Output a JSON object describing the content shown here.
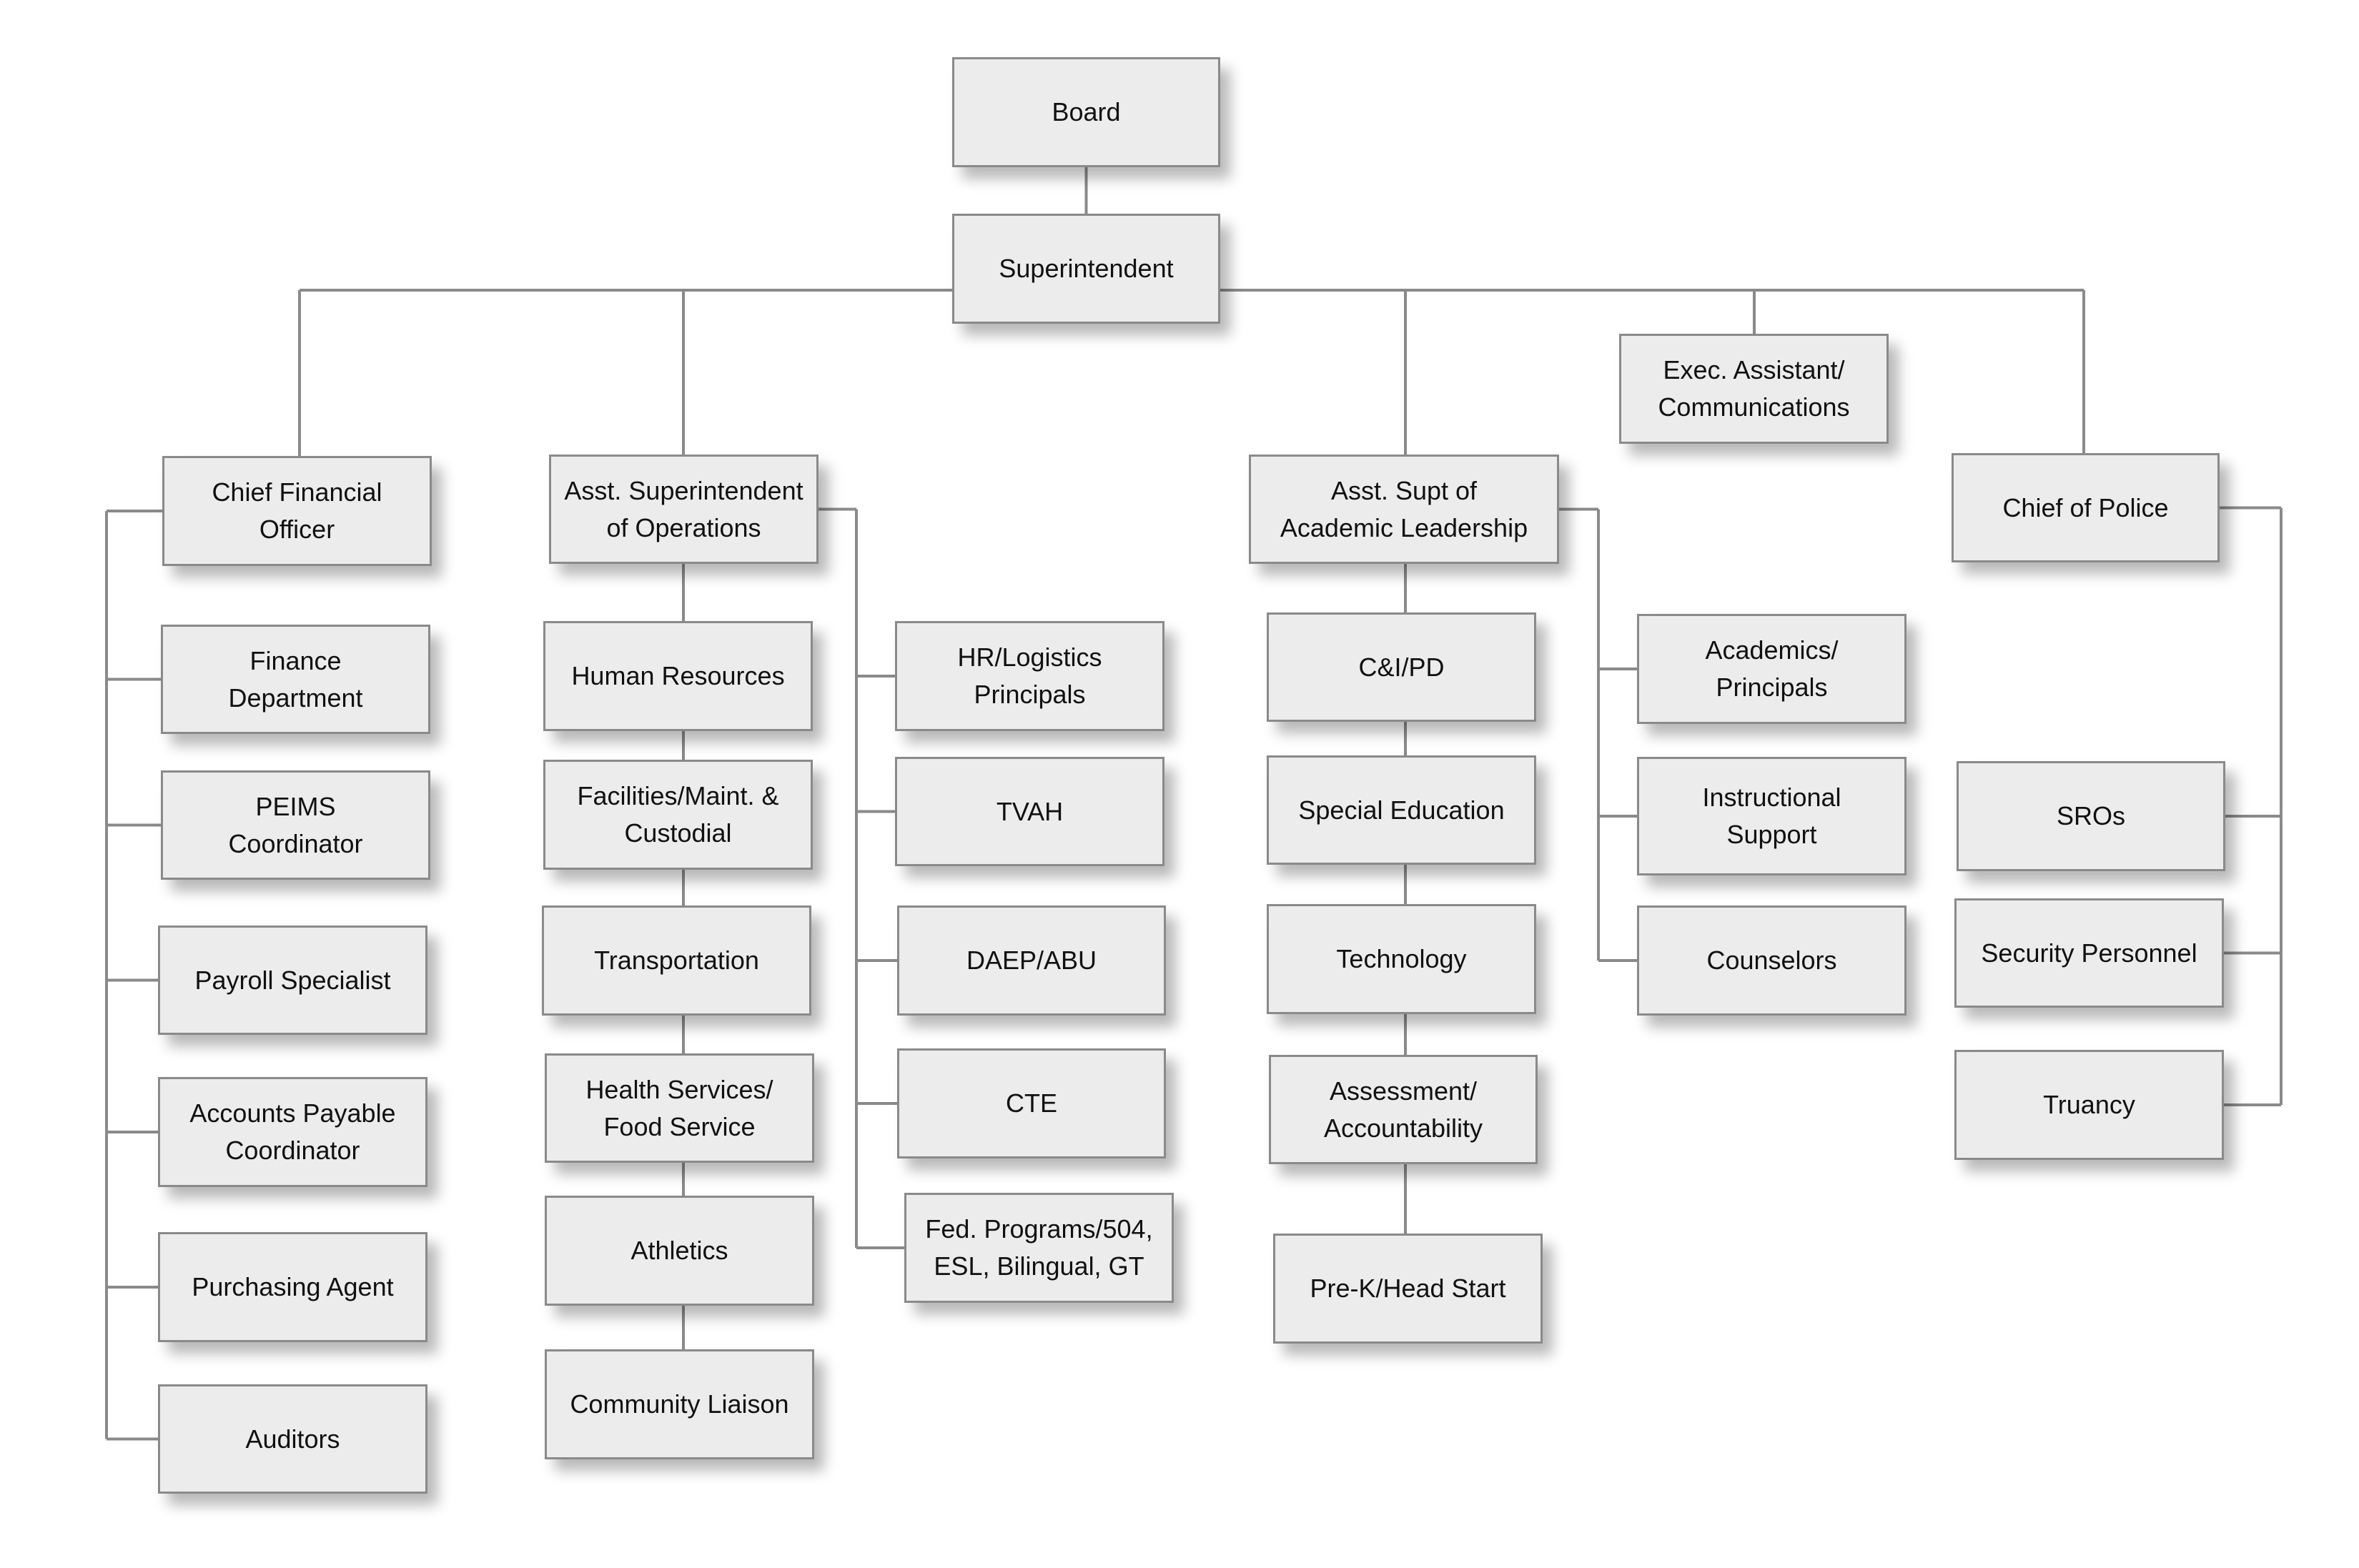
{
  "chart": {
    "type": "org-chart",
    "line_color": "#8a8a8a",
    "box_fill": "#ececec",
    "nodes": [
      {
        "id": "board",
        "label": "Board"
      },
      {
        "id": "superintendent",
        "label": "Superintendent",
        "parent": "board"
      },
      {
        "id": "cfo",
        "label": "Chief Financial\nOfficer",
        "parent": "superintendent"
      },
      {
        "id": "ops",
        "label": "Asst. Superintendent\nof Operations",
        "parent": "superintendent"
      },
      {
        "id": "academic",
        "label": "Asst. Supt of\nAcademic Leadership",
        "parent": "superintendent"
      },
      {
        "id": "exec",
        "label": "Exec. Assistant/\nCommunications",
        "parent": "superintendent"
      },
      {
        "id": "police",
        "label": "Chief of Police",
        "parent": "superintendent"
      },
      {
        "id": "finance",
        "label": "Finance\nDepartment",
        "parent": "cfo"
      },
      {
        "id": "peims",
        "label": "PEIMS\nCoordinator",
        "parent": "cfo"
      },
      {
        "id": "payroll",
        "label": "Payroll Specialist",
        "parent": "cfo"
      },
      {
        "id": "ap",
        "label": "Accounts Payable\nCoordinator",
        "parent": "cfo"
      },
      {
        "id": "purchasing",
        "label": "Purchasing Agent",
        "parent": "cfo"
      },
      {
        "id": "auditors",
        "label": "Auditors",
        "parent": "cfo"
      },
      {
        "id": "hr",
        "label": "Human Resources",
        "parent": "ops"
      },
      {
        "id": "facilities",
        "label": "Facilities/Maint. &\nCustodial",
        "parent": "ops"
      },
      {
        "id": "transportation",
        "label": "Transportation",
        "parent": "ops"
      },
      {
        "id": "health",
        "label": "Health Services/\nFood Service",
        "parent": "ops"
      },
      {
        "id": "athletics",
        "label": "Athletics",
        "parent": "ops"
      },
      {
        "id": "community",
        "label": "Community Liaison",
        "parent": "ops"
      },
      {
        "id": "hrlog",
        "label": "HR/Logistics\nPrincipals",
        "parent": "ops"
      },
      {
        "id": "tvah",
        "label": "TVAH",
        "parent": "ops"
      },
      {
        "id": "daep",
        "label": "DAEP/ABU",
        "parent": "ops"
      },
      {
        "id": "cte",
        "label": "CTE",
        "parent": "ops"
      },
      {
        "id": "fed",
        "label": "Fed. Programs/504,\nESL, Bilingual, GT",
        "parent": "ops"
      },
      {
        "id": "ci",
        "label": "C&I/PD",
        "parent": "academic"
      },
      {
        "id": "sped",
        "label": "Special Education",
        "parent": "academic"
      },
      {
        "id": "tech",
        "label": "Technology",
        "parent": "academic"
      },
      {
        "id": "assess",
        "label": "Assessment/\nAccountability",
        "parent": "academic"
      },
      {
        "id": "prek",
        "label": "Pre-K/Head Start",
        "parent": "academic"
      },
      {
        "id": "acad",
        "label": "Academics/\nPrincipals",
        "parent": "academic"
      },
      {
        "id": "instr",
        "label": "Instructional\nSupport",
        "parent": "academic"
      },
      {
        "id": "couns",
        "label": "Counselors",
        "parent": "academic"
      },
      {
        "id": "sros",
        "label": "SROs",
        "parent": "police"
      },
      {
        "id": "security",
        "label": "Security Personnel",
        "parent": "police"
      },
      {
        "id": "truancy",
        "label": "Truancy",
        "parent": "police"
      }
    ]
  }
}
